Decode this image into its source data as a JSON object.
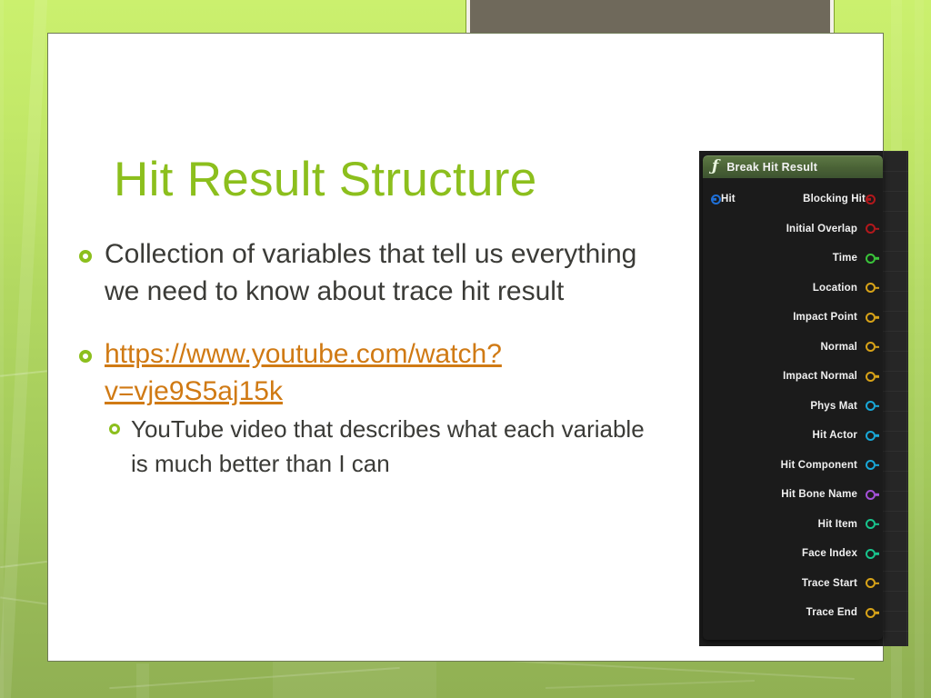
{
  "slide": {
    "title": "Hit Result Structure",
    "title_color": "#8cbf1d",
    "background_top_color": "#cbf06e",
    "background_bottom_color": "#90b053",
    "content_background": "#ffffff",
    "top_block_color": "#6f695b"
  },
  "body": {
    "bullets": [
      {
        "level": 1,
        "text": "Collection of variables that tell us everything we need to know about trace hit result",
        "is_link": false
      },
      {
        "level": 1,
        "text": "https://www.youtube.com/watch?v=vje9S5aj15k",
        "is_link": true,
        "link_color": "#d07a14"
      },
      {
        "level": 2,
        "text": "YouTube video that describes what each variable is much better than I can",
        "is_link": false
      }
    ],
    "bullet_marker": "green-ring-bullet",
    "bullet_color": "#8cbf1d",
    "text_color": "#3b3b37"
  },
  "blueprint_node": {
    "title": "Break Hit Result",
    "icon": "function-f-icon",
    "header_color": "#4a6236",
    "body_color": "#1b1b1b",
    "inputs": [
      {
        "label": "Hit",
        "color": "#1f6fd6"
      }
    ],
    "outputs": [
      {
        "label": "Blocking Hit",
        "color": "#b3181c"
      },
      {
        "label": "Initial Overlap",
        "color": "#b3181c"
      },
      {
        "label": "Time",
        "color": "#3ac43a"
      },
      {
        "label": "Location",
        "color": "#d8a318"
      },
      {
        "label": "Impact Point",
        "color": "#d8a318"
      },
      {
        "label": "Normal",
        "color": "#d8a318"
      },
      {
        "label": "Impact Normal",
        "color": "#d8a318"
      },
      {
        "label": "Phys Mat",
        "color": "#19a8d8"
      },
      {
        "label": "Hit Actor",
        "color": "#19a8d8"
      },
      {
        "label": "Hit Component",
        "color": "#19a8d8"
      },
      {
        "label": "Hit Bone Name",
        "color": "#a450d8"
      },
      {
        "label": "Hit Item",
        "color": "#18c48c"
      },
      {
        "label": "Face Index",
        "color": "#18c48c"
      },
      {
        "label": "Trace Start",
        "color": "#d8a318"
      },
      {
        "label": "Trace End",
        "color": "#d8a318"
      }
    ]
  }
}
